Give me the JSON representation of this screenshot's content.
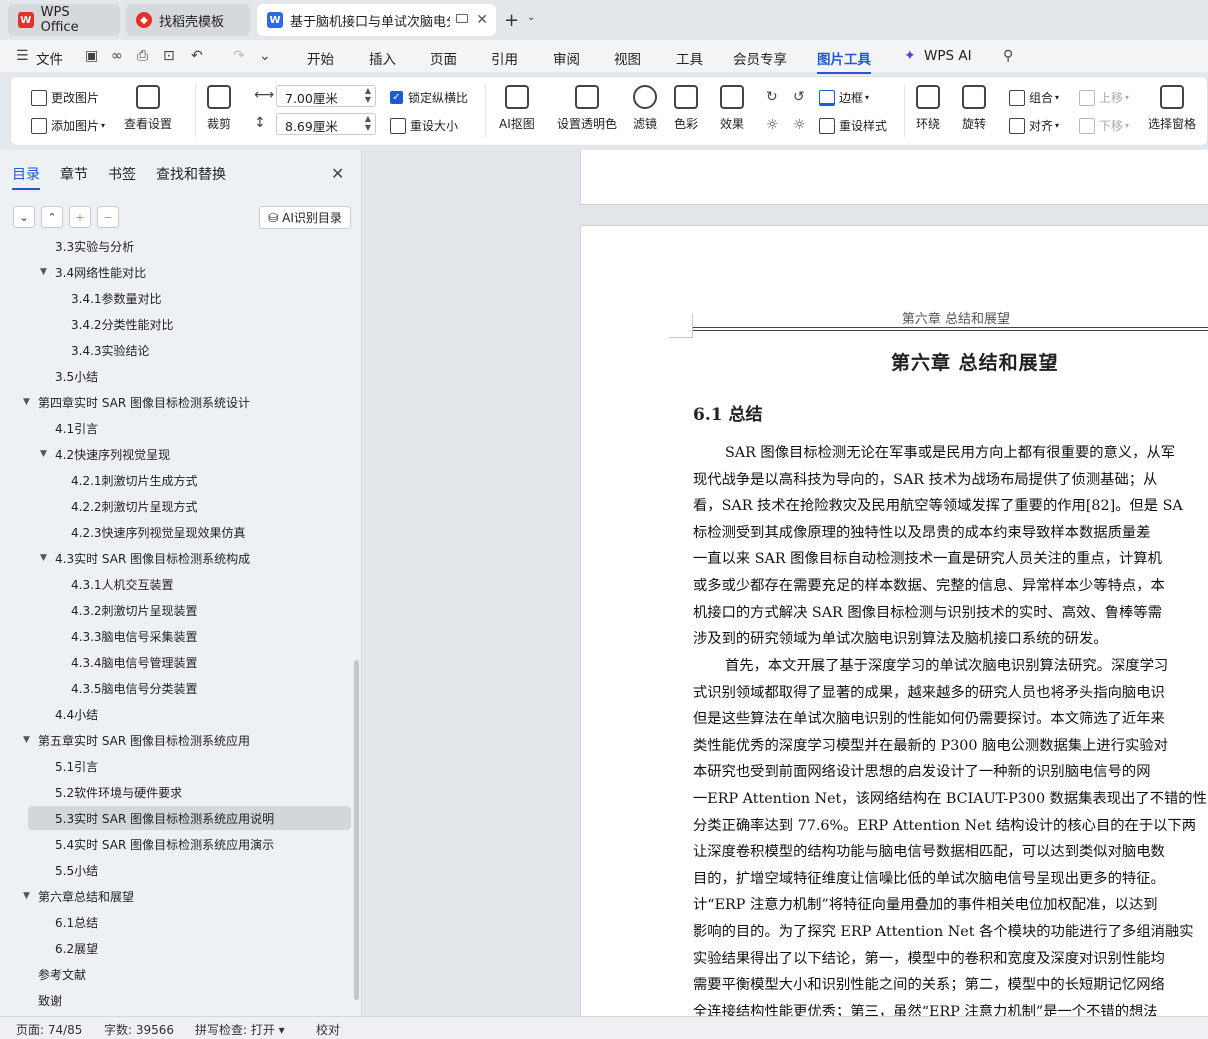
{
  "tabs": [
    {
      "label": "WPS Office"
    },
    {
      "label": "找稻壳模板"
    },
    {
      "label": "基于脑机接口与单试次脑电分"
    }
  ],
  "menu": {
    "file": "文件",
    "items": [
      "开始",
      "插入",
      "页面",
      "引用",
      "审阅",
      "视图",
      "工具",
      "会员专享",
      "图片工具",
      "WPS AI"
    ]
  },
  "ribbon": {
    "change_pic": "更改图片",
    "add_pic": "添加图片",
    "view_settings": "查看设置",
    "crop": "裁剪",
    "width": "7.00厘米",
    "height": "8.69厘米",
    "lock_ratio": "锁定纵横比",
    "reset_size": "重设大小",
    "ai_cutout": "AI抠图",
    "set_transparent": "设置透明色",
    "filter": "滤镜",
    "color": "色彩",
    "effect": "效果",
    "border": "边框",
    "reset_style": "重设样式",
    "wrap": "环绕",
    "rotate": "旋转",
    "group": "组合",
    "align": "对齐",
    "move_up": "上移",
    "move_down": "下移",
    "select_pane": "选择窗格"
  },
  "sidebar": {
    "tabs": [
      "目录",
      "章节",
      "书签",
      "查找和替换"
    ],
    "ai_toc": "AI识别目录",
    "toc": [
      {
        "label": "3.3实验与分析",
        "level": 2
      },
      {
        "label": "3.4网络性能对比",
        "level": 2,
        "expanded": true
      },
      {
        "label": "3.4.1参数量对比",
        "level": 3
      },
      {
        "label": "3.4.2分类性能对比",
        "level": 3
      },
      {
        "label": "3.4.3实验结论",
        "level": 3
      },
      {
        "label": "3.5小结",
        "level": 2
      },
      {
        "label": "第四章实时 SAR 图像目标检测系统设计",
        "level": 1,
        "expanded": true
      },
      {
        "label": "4.1引言",
        "level": 2
      },
      {
        "label": "4.2快速序列视觉呈现",
        "level": 2,
        "expanded": true
      },
      {
        "label": "4.2.1刺激切片生成方式",
        "level": 3
      },
      {
        "label": "4.2.2刺激切片呈现方式",
        "level": 3
      },
      {
        "label": "4.2.3快速序列视觉呈现效果仿真",
        "level": 3
      },
      {
        "label": "4.3实时 SAR 图像目标检测系统构成",
        "level": 2,
        "expanded": true
      },
      {
        "label": "4.3.1人机交互装置",
        "level": 3
      },
      {
        "label": "4.3.2刺激切片呈现装置",
        "level": 3
      },
      {
        "label": "4.3.3脑电信号采集装置",
        "level": 3
      },
      {
        "label": "4.3.4脑电信号管理装置",
        "level": 3
      },
      {
        "label": "4.3.5脑电信号分类装置",
        "level": 3
      },
      {
        "label": "4.4小结",
        "level": 2
      },
      {
        "label": "第五章实时 SAR 图像目标检测系统应用",
        "level": 1,
        "expanded": true
      },
      {
        "label": "5.1引言",
        "level": 2
      },
      {
        "label": "5.2软件环境与硬件要求",
        "level": 2
      },
      {
        "label": "5.3实时 SAR 图像目标检测系统应用说明",
        "level": 2,
        "selected": true
      },
      {
        "label": "5.4实时 SAR 图像目标检测系统应用演示",
        "level": 2
      },
      {
        "label": "5.5小结",
        "level": 2
      },
      {
        "label": "第六章总结和展望",
        "level": 1,
        "expanded": true
      },
      {
        "label": "6.1总结",
        "level": 2
      },
      {
        "label": "6.2展望",
        "level": 2
      },
      {
        "label": "参考文献",
        "level": 1
      },
      {
        "label": "致谢",
        "level": 1
      }
    ]
  },
  "document": {
    "header": "第六章  总结和展望",
    "chapter_title": "第六章   总结和展望",
    "section_title": "6.1 总结",
    "para1": [
      "SAR 图像目标检测无论在军事或是民用方向上都有很重要的意义，从军",
      "现代战争是以高科技为导向的，SAR 技术为战场布局提供了侦测基础；从",
      "看，SAR 技术在抢险救灾及民用航空等领域发挥了重要的作用[82]。但是 SA",
      "标检测受到其成像原理的独特性以及昂贵的成本约束导致样本数据质量差",
      "一直以来 SAR 图像目标自动检测技术一直是研究人员关注的重点，计算机",
      "或多或少都存在需要充足的样本数据、完整的信息、异常样本少等特点，本",
      "机接口的方式解决 SAR 图像目标检测与识别技术的实时、高效、鲁棒等需",
      "涉及到的研究领域为单试次脑电识别算法及脑机接口系统的研发。"
    ],
    "para2": [
      "首先，本文开展了基于深度学习的单试次脑电识别算法研究。深度学习",
      "式识别领域都取得了显著的成果，越来越多的研究人员也将矛头指向脑电识",
      "但是这些算法在单试次脑电识别的性能如何仍需要探讨。本文筛选了近年来",
      "类性能优秀的深度学习模型并在最新的 P300 脑电公测数据集上进行实验对",
      "本研究也受到前面网络设计思想的启发设计了一种新的识别脑电信号的网",
      "一ERP Attention Net，该网络结构在 BCIAUT-P300 数据集表现出了不错的性",
      "分类正确率达到 77.6%。ERP Attention Net 结构设计的核心目的在于以下两",
      "让深度卷积模型的结构功能与脑电信号数据相匹配，可以达到类似对脑电数",
      "目的，扩增空域特征维度让信噪比低的单试次脑电信号呈现出更多的特征。",
      "计“ERP 注意力机制”将特征向量用叠加的事件相关电位加权配准，以达到",
      "影响的目的。为了探究 ERP Attention Net 各个模块的功能进行了多组消融实",
      "实验结果得出了以下结论，第一，模型中的卷积和宽度及深度对识别性能均",
      "需要平衡模型大小和识别性能之间的关系；第二，模型中的长短期记忆网络",
      "全连接结构性能更优秀；第三，虽然“ERP 注意力机制”是一个不错的想法"
    ]
  },
  "status": {
    "page": "页面: 74/85",
    "words": "字数: 39566",
    "spell": "拼写检查: 打开",
    "proof": "校对"
  }
}
